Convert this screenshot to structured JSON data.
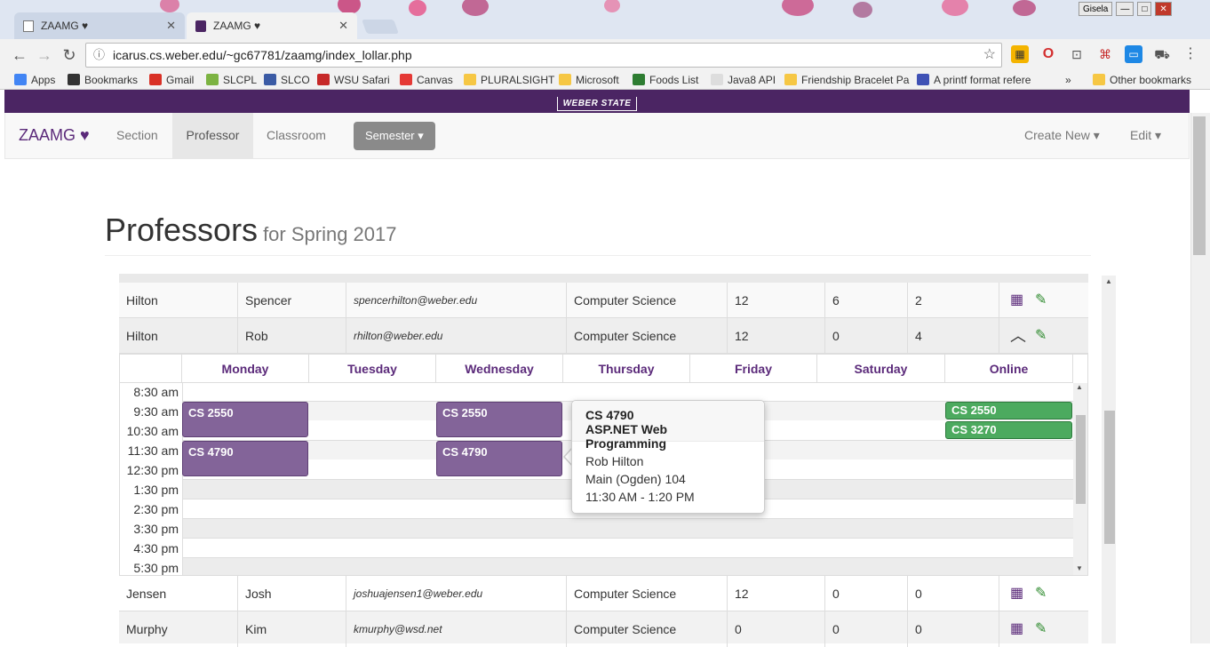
{
  "browser": {
    "tabs": [
      {
        "label": "ZAAMG ♥"
      },
      {
        "label": "ZAAMG ♥"
      }
    ],
    "url": "icarus.cs.weber.edu/~gc67781/zaamg/index_lollar.php",
    "profile": "Gisela",
    "bookmarks": [
      {
        "label": "Apps",
        "icon_color": "#4285f4"
      },
      {
        "label": "Bookmarks",
        "icon_color": "#333333"
      },
      {
        "label": "Gmail",
        "icon_color": "#d93025"
      },
      {
        "label": "SLCPL",
        "icon_color": "#7cb342"
      },
      {
        "label": "SLCO",
        "icon_color": "#3b5ba5"
      },
      {
        "label": "WSU Safari",
        "icon_color": "#c62828"
      },
      {
        "label": "Canvas",
        "icon_color": "#e53935"
      },
      {
        "label": "PLURALSIGHT",
        "icon_color": "#f6c744"
      },
      {
        "label": "Microsoft",
        "icon_color": "#f6c744"
      },
      {
        "label": "Foods List",
        "icon_color": "#2e7d32"
      },
      {
        "label": "Java8 API",
        "icon_color": "#dddddd"
      },
      {
        "label": "Friendship Bracelet Pa",
        "icon_color": "#f6c744"
      },
      {
        "label": "A printf format refere",
        "icon_color": "#3f51b5"
      }
    ],
    "other_bookmarks": "Other bookmarks",
    "more_bookmarks": "»"
  },
  "banner": {
    "text": "WEBER STATE"
  },
  "nav": {
    "brand": "ZAAMG ♥",
    "items": [
      {
        "label": "Section"
      },
      {
        "label": "Professor"
      },
      {
        "label": "Classroom"
      }
    ],
    "semester": "Semester ▾",
    "create_new": "Create New ▾",
    "edit": "Edit ▾"
  },
  "page": {
    "title": "Professors",
    "subtitle": "for Spring 2017"
  },
  "professors": [
    {
      "last": "Hilton",
      "first": "Spencer",
      "email": "spencerhilton@weber.edu",
      "dept": "Computer Science",
      "n1": "12",
      "n2": "6",
      "n3": "2"
    },
    {
      "last": "Hilton",
      "first": "Rob",
      "email": "rhilton@weber.edu",
      "dept": "Computer Science",
      "n1": "12",
      "n2": "0",
      "n3": "4"
    },
    {
      "last": "Jensen",
      "first": "Josh",
      "email": "joshuajensen1@weber.edu",
      "dept": "Computer Science",
      "n1": "12",
      "n2": "0",
      "n3": "0"
    },
    {
      "last": "Murphy",
      "first": "Kim",
      "email": "kmurphy@wsd.net",
      "dept": "Computer Science",
      "n1": "0",
      "n2": "0",
      "n3": "0"
    }
  ],
  "schedule": {
    "days": [
      "Monday",
      "Tuesday",
      "Wednesday",
      "Thursday",
      "Friday",
      "Saturday",
      "Online"
    ],
    "times": [
      "8:30 am",
      "9:30 am",
      "10:30 am",
      "11:30 am",
      "12:30 pm",
      "1:30 pm",
      "2:30 pm",
      "3:30 pm",
      "4:30 pm",
      "5:30 pm"
    ],
    "events": [
      {
        "label": "CS 2550",
        "day": "Monday"
      },
      {
        "label": "CS 4790",
        "day": "Monday"
      },
      {
        "label": "CS 2550",
        "day": "Wednesday"
      },
      {
        "label": "CS 4790",
        "day": "Wednesday"
      },
      {
        "label": "CS 2550",
        "day": "Online"
      },
      {
        "label": "CS 3270",
        "day": "Online"
      }
    ]
  },
  "popover": {
    "course": "CS 4790",
    "name": "ASP.NET Web Programming",
    "professor": "Rob Hilton",
    "room": "Main (Ogden) 104",
    "time": "11:30 AM - 1:20 PM"
  },
  "colors": {
    "primary": "#4b2563",
    "event": "#836499",
    "online_event": "#4caa5f",
    "edit_icon": "#2d8a2d"
  }
}
